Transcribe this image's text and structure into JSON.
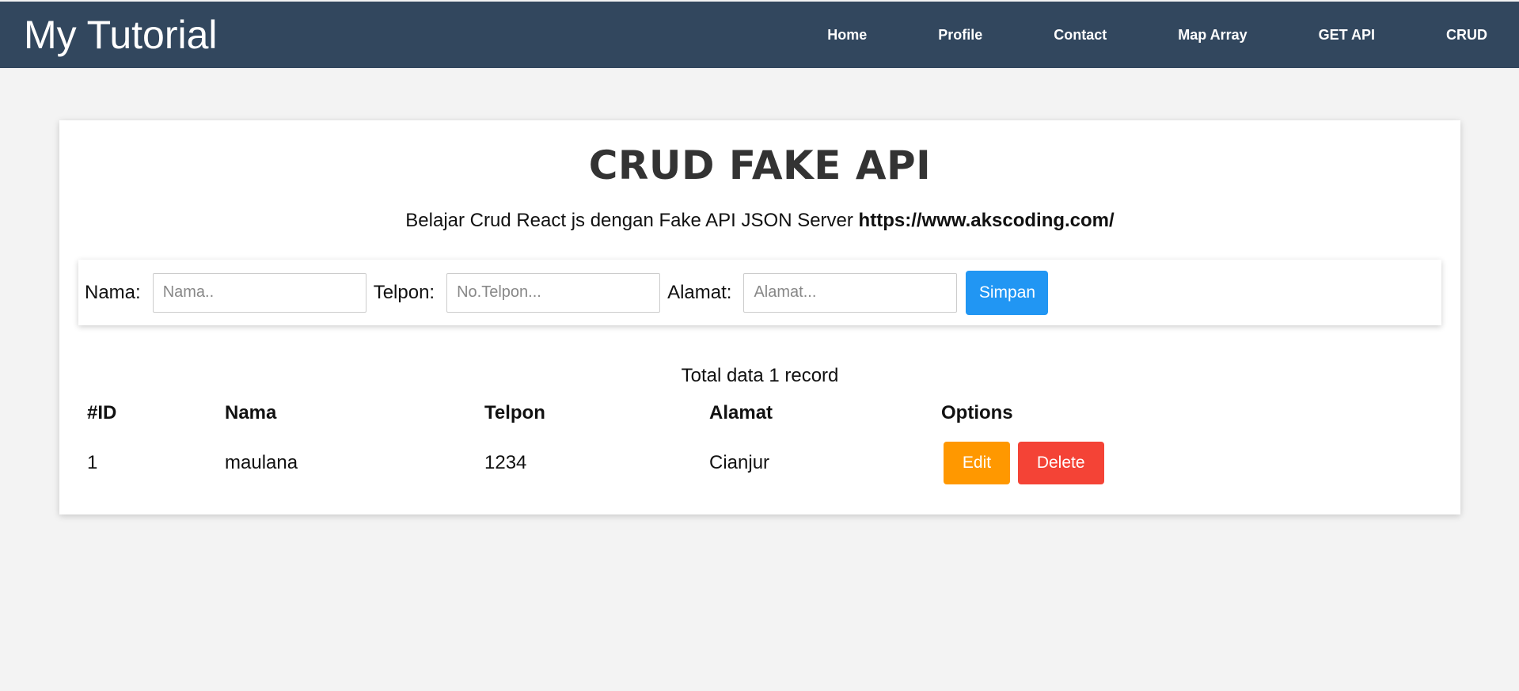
{
  "navbar": {
    "brand": "My Tutorial",
    "links": [
      "Home",
      "Profile",
      "Contact",
      "Map Array",
      "GET API",
      "CRUD"
    ]
  },
  "page": {
    "title": "CRUD FAKE API",
    "subtitle_text": "Belajar Crud React js dengan Fake API JSON Server",
    "subtitle_link": "https://www.akscoding.com/"
  },
  "form": {
    "nama_label": "Nama:",
    "nama_placeholder": "Nama..",
    "telpon_label": "Telpon:",
    "telpon_placeholder": "No.Telpon...",
    "alamat_label": "Alamat:",
    "alamat_placeholder": "Alamat...",
    "save_label": "Simpan"
  },
  "table": {
    "total_text": "Total data 1 record",
    "headers": [
      "#ID",
      "Nama",
      "Telpon",
      "Alamat",
      "Options"
    ],
    "rows": [
      {
        "id": "1",
        "nama": "maulana",
        "telpon": "1234",
        "alamat": "Cianjur"
      }
    ],
    "edit_label": "Edit",
    "delete_label": "Delete"
  },
  "colors": {
    "navbar_bg": "#32475e",
    "save_button": "#2196f3",
    "edit_button": "#ff9800",
    "delete_button": "#f44336"
  }
}
